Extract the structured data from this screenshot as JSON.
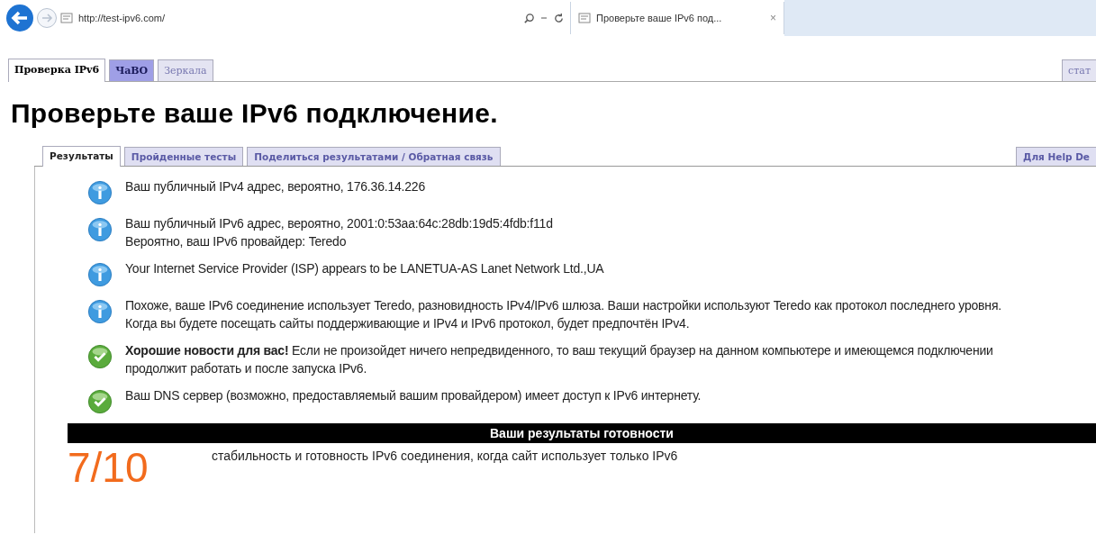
{
  "browser": {
    "address": "http://test-ipv6.com/",
    "tab_title": "Проверьте ваше IPv6 под...",
    "tab_close": "×"
  },
  "site_tabs": [
    {
      "label": "Проверка IPv6",
      "selected": true,
      "highlighted": false
    },
    {
      "label": "ЧаВО",
      "selected": false,
      "highlighted": true
    },
    {
      "label": "Зеркала",
      "selected": false,
      "highlighted": false
    }
  ],
  "site_tab_right": "стат",
  "heading": "Проверьте ваше IPv6 подключение.",
  "content_tabs": [
    {
      "label": "Результаты",
      "selected": true
    },
    {
      "label": "Пройденные тесты",
      "selected": false
    },
    {
      "label": "Поделиться результатами / Обратная связь",
      "selected": false
    }
  ],
  "content_tab_right": "Для Help De",
  "messages": [
    {
      "kind": "info",
      "lines": [
        "Ваш публичный IPv4 адрес, вероятно, 176.36.14.226"
      ]
    },
    {
      "kind": "info",
      "lines": [
        "Ваш публичный IPv6 адрес, вероятно, 2001:0:53aa:64c:28db:19d5:4fdb:f11d",
        "Вероятно, ваш IPv6 провайдер: Teredo"
      ]
    },
    {
      "kind": "info",
      "lines": [
        "Your Internet Service Provider (ISP) appears to be LANETUA-AS Lanet Network Ltd.,UA"
      ]
    },
    {
      "kind": "info",
      "lines": [
        "Похоже, ваше IPv6 соединение использует Teredo, разновидность IPv4/IPv6 шлюза. Ваши настройки используют Teredo как протокол последнего уровня. Когда вы будете посещать сайты поддерживающие и IPv4 и IPv6 протокол, будет предпочтён IPv4."
      ]
    },
    {
      "kind": "ok",
      "lines": [
        "**Хорошие новости для вас!** Если не произойдет ничего непредвиденного, то ваш текущий браузер на данном компьютере и имеющемся подключении продолжит работать и после запуска IPv6."
      ]
    },
    {
      "kind": "ok",
      "lines": [
        "Ваш DNS сервер (возможно, предоставляемый вашим провайдером) имеет доступ к IPv6 интернету."
      ]
    }
  ],
  "readiness": {
    "title": "Ваши результаты готовности",
    "score": "7/10",
    "description": "стабильность и готовность IPv6 соединения, когда сайт использует только IPv6"
  }
}
